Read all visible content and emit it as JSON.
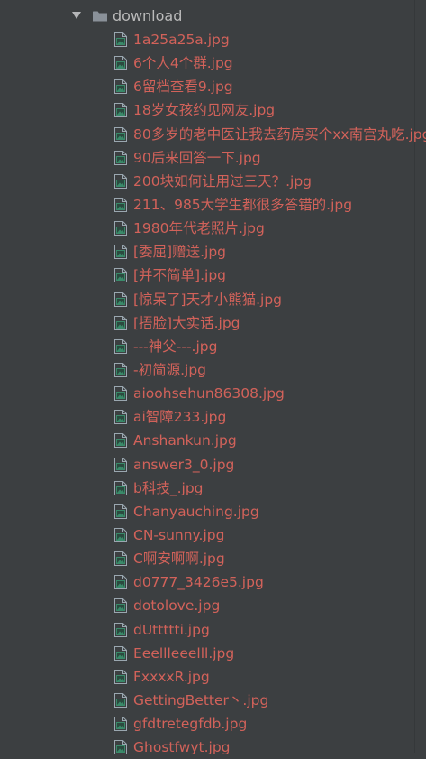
{
  "colors": {
    "background": "#3c3f41",
    "folder_text": "#bbbbbb",
    "file_text": "#d2625a",
    "icon_gray": "#9aa7b0",
    "icon_accent": "#3a8a6a"
  },
  "tree": {
    "folder": {
      "label": "download",
      "expanded": true,
      "icon": "folder-icon"
    },
    "files": [
      {
        "label": "1a25a25a.jpg",
        "icon": "image-file-icon"
      },
      {
        "label": "6个人4个群.jpg",
        "icon": "image-file-icon"
      },
      {
        "label": "6留档查看9.jpg",
        "icon": "image-file-icon"
      },
      {
        "label": "18岁女孩约见网友.jpg",
        "icon": "image-file-icon"
      },
      {
        "label": "80多岁的老中医让我去药房买个xx南宫丸吃.jpg",
        "icon": "image-file-icon"
      },
      {
        "label": "90后来回答一下.jpg",
        "icon": "image-file-icon"
      },
      {
        "label": "200块如何让用过三天？.jpg",
        "icon": "image-file-icon"
      },
      {
        "label": "211、985大学生都很多答错的.jpg",
        "icon": "image-file-icon"
      },
      {
        "label": "1980年代老照片.jpg",
        "icon": "image-file-icon"
      },
      {
        "label": "[委屈]赠送.jpg",
        "icon": "image-file-icon"
      },
      {
        "label": "[并不简单].jpg",
        "icon": "image-file-icon"
      },
      {
        "label": "[惊呆了]天才小熊猫.jpg",
        "icon": "image-file-icon"
      },
      {
        "label": "[捂脸]大实话.jpg",
        "icon": "image-file-icon"
      },
      {
        "label": "---神父---.jpg",
        "icon": "image-file-icon"
      },
      {
        "label": "-初简源.jpg",
        "icon": "image-file-icon"
      },
      {
        "label": "aioohsehun86308.jpg",
        "icon": "image-file-icon"
      },
      {
        "label": "ai智障233.jpg",
        "icon": "image-file-icon"
      },
      {
        "label": "Anshankun.jpg",
        "icon": "image-file-icon"
      },
      {
        "label": "answer3_0.jpg",
        "icon": "image-file-icon"
      },
      {
        "label": "b科技_.jpg",
        "icon": "image-file-icon"
      },
      {
        "label": "Chanyauching.jpg",
        "icon": "image-file-icon"
      },
      {
        "label": "CN-sunny.jpg",
        "icon": "image-file-icon"
      },
      {
        "label": "C啊安啊啊.jpg",
        "icon": "image-file-icon"
      },
      {
        "label": "d0777_3426e5.jpg",
        "icon": "image-file-icon"
      },
      {
        "label": "dotolove.jpg",
        "icon": "image-file-icon"
      },
      {
        "label": "dUttttti.jpg",
        "icon": "image-file-icon"
      },
      {
        "label": "Eeellleeelll.jpg",
        "icon": "image-file-icon"
      },
      {
        "label": "FxxxxR.jpg",
        "icon": "image-file-icon"
      },
      {
        "label": "GettingBetter丶.jpg",
        "icon": "image-file-icon"
      },
      {
        "label": "gfdtretegfdb.jpg",
        "icon": "image-file-icon"
      },
      {
        "label": "Ghostfwyt.jpg",
        "icon": "image-file-icon"
      }
    ]
  }
}
